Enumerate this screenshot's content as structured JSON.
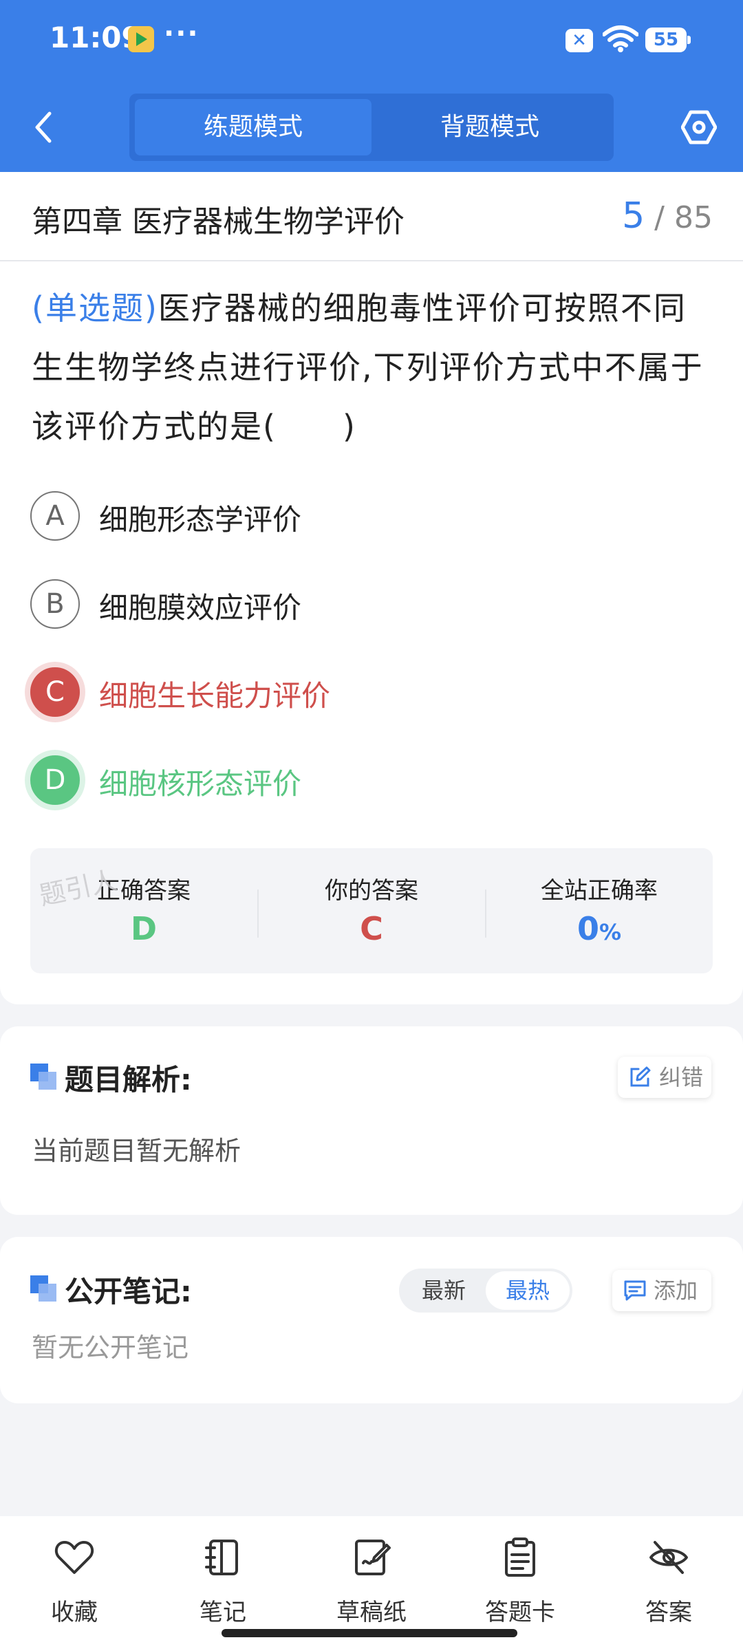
{
  "status_bar": {
    "time": "11:09",
    "dots": "···",
    "x_badge": "✕",
    "battery": "55"
  },
  "header": {
    "mode_practice": "练题模式",
    "mode_recite": "背题模式",
    "accent_color": "#3a7fe8"
  },
  "chapter": {
    "title": "第四章 医疗器械生物学评价",
    "current": "5",
    "separator": "/",
    "total": "85"
  },
  "question": {
    "type_label": "(单选题)",
    "text": "医疗器械的细胞毒性评价可按照不同生生物学终点进行评价,下列评价方式中不属于该评价方式的是(　　)"
  },
  "options": [
    {
      "letter": "A",
      "text": "细胞形态学评价",
      "state": "normal"
    },
    {
      "letter": "B",
      "text": "细胞膜效应评价",
      "state": "normal"
    },
    {
      "letter": "C",
      "text": "细胞生长能力评价",
      "state": "wrong"
    },
    {
      "letter": "D",
      "text": "细胞核形态评价",
      "state": "correct"
    }
  ],
  "result": {
    "correct_label": "正确答案",
    "correct_value": "D",
    "yours_label": "你的答案",
    "yours_value": "C",
    "rate_label": "全站正确率",
    "rate_value": "0",
    "rate_unit": "%",
    "watermark": "题引人"
  },
  "analysis": {
    "title": "题目解析:",
    "report_label": "纠错",
    "body": "当前题目暂无解析"
  },
  "notes": {
    "title": "公开笔记:",
    "sort_latest": "最新",
    "sort_hot": "最热",
    "add_label": "添加",
    "body": "暂无公开笔记"
  },
  "bottom_nav": {
    "favorite": "收藏",
    "notes": "笔记",
    "draft": "草稿纸",
    "answer_card": "答题卡",
    "answer": "答案"
  },
  "colors": {
    "wrong": "#cf4f4c",
    "correct": "#5ac682"
  }
}
